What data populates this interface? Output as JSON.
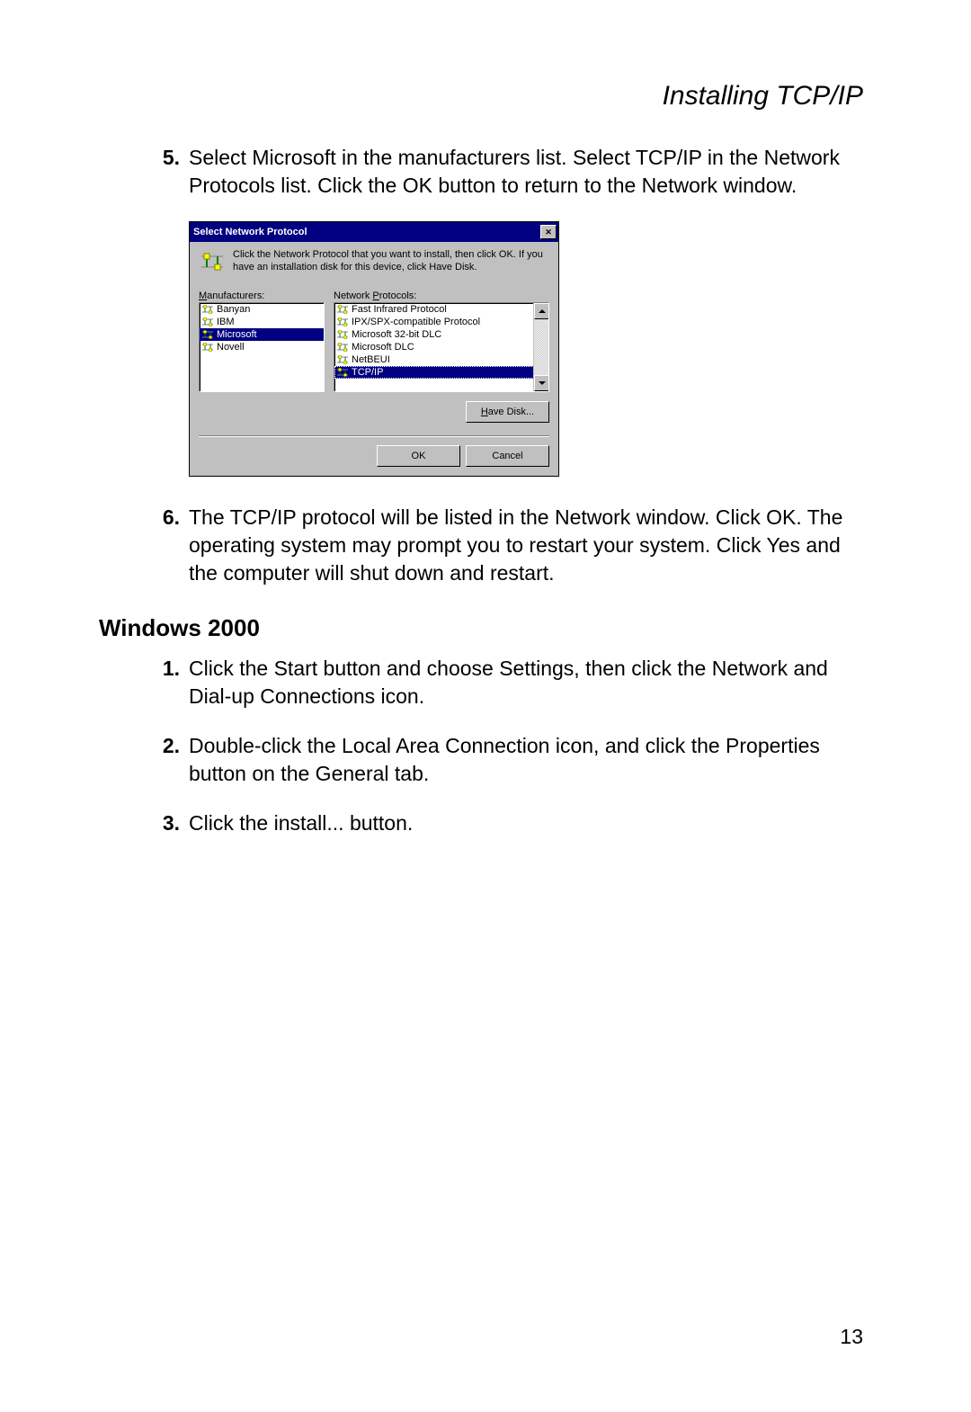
{
  "header": {
    "title": "Installing TCP/IP"
  },
  "steps": {
    "five": {
      "num": "5.",
      "text": "Select Microsoft in the manufacturers list. Select TCP/IP in the Network Protocols list. Click the OK button to return to the Network window."
    },
    "six": {
      "num": "6.",
      "text": "The TCP/IP protocol will be listed in the Network window. Click OK. The operating system may prompt you to restart your system. Click Yes and the computer will shut down and restart."
    }
  },
  "section2": {
    "heading": "Windows 2000",
    "one": {
      "num": "1.",
      "text": "Click the Start button and choose Settings, then click the Network and Dial-up Connections icon."
    },
    "two": {
      "num": "2.",
      "text": "Double-click the Local Area Connection icon, and click the Properties button on the General tab."
    },
    "three": {
      "num": "3.",
      "text": "Click the install... button."
    }
  },
  "dialog": {
    "title": "Select Network Protocol",
    "instruction": "Click the Network Protocol that you want to install, then click OK. If you have an installation disk for this device, click Have Disk.",
    "manufacturers_label": "Manufacturers:",
    "protocols_label": "Network Protocols:",
    "manufacturers": [
      "Banyan",
      "IBM",
      "Microsoft",
      "Novell"
    ],
    "selected_manufacturer_index": 2,
    "protocols": [
      "Fast Infrared Protocol",
      "IPX/SPX-compatible Protocol",
      "Microsoft 32-bit DLC",
      "Microsoft DLC",
      "NetBEUI",
      "TCP/IP"
    ],
    "selected_protocol_index": 5,
    "have_disk": "Have Disk...",
    "ok": "OK",
    "cancel": "Cancel"
  },
  "page_number": "13"
}
